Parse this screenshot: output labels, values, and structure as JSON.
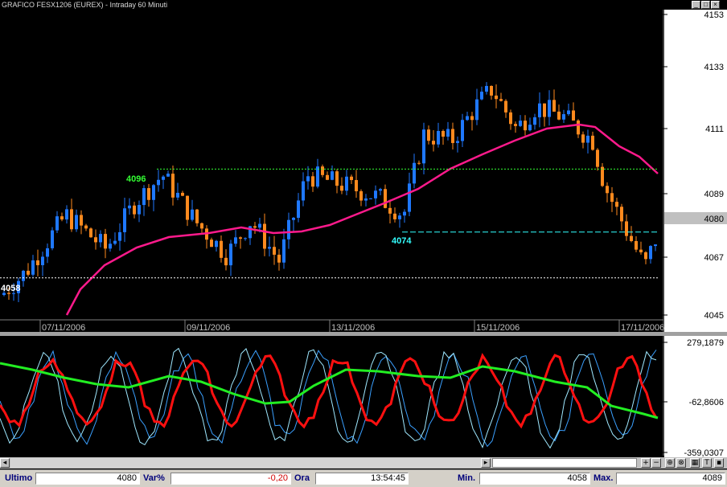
{
  "window": {
    "title": "GRAFICO FESX1206 (EUREX) - Intraday 60 Minuti",
    "controls": [
      "_",
      "□",
      "×"
    ]
  },
  "price_axis": {
    "ticks": [
      "4153",
      "4133",
      "4111",
      "4089",
      "4067",
      "4045"
    ],
    "current_value": "4080"
  },
  "date_axis": {
    "labels": [
      "07/11/2006",
      "09/11/2006",
      "13/11/2006",
      "15/11/2006",
      "17/11/2006"
    ]
  },
  "annotations": {
    "level_high": "4096",
    "level_low": "4058",
    "level_mid": "4074"
  },
  "oscillator_axis": {
    "ticks": [
      "279,1879",
      "-62,8606",
      "-359,0307"
    ]
  },
  "toolbar": {
    "buttons": [
      "+",
      "−",
      "⊕",
      "⊗",
      "▦",
      "T"
    ]
  },
  "statusbar": {
    "last_label": "Ultimo",
    "last_value": "4080",
    "var_label": "Var%",
    "var_value": "-0,20",
    "time_label": "Ora",
    "time_value": "13:54:45",
    "min_label": "Min.",
    "min_value": "4058",
    "max_label": "Max.",
    "max_value": "4089"
  },
  "colors": {
    "bull": "#1f78ff",
    "bear": "#ff8a1e",
    "moving_average": "#ff1a8c",
    "osc_red": "#ff1010",
    "osc_green": "#22ee22",
    "osc_blue": "#3aa0ff",
    "osc_cyan": "#9fe8ff",
    "label_green": "#33ff33",
    "label_cyan": "#33ffff"
  }
}
